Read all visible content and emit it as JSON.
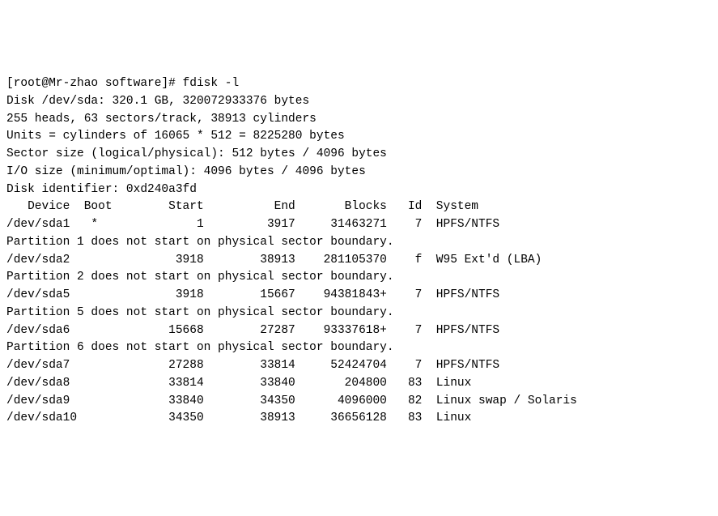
{
  "prompt": {
    "user": "root",
    "host": "Mr-zhao",
    "cwd": "software",
    "symbol": "#",
    "command": "fdisk -l"
  },
  "disk": {
    "device": "/dev/sda",
    "size": "320.1 GB",
    "bytes": "320072933376",
    "heads": "255",
    "sectors_per_track": "63",
    "cylinders": "38913",
    "units": "cylinders of 16065 * 512 = 8225280 bytes",
    "sector_size": "512 bytes / 4096 bytes",
    "io_size": "4096 bytes / 4096 bytes",
    "identifier": "0xd240a3fd"
  },
  "header": {
    "device": "Device",
    "boot": "Boot",
    "start": "Start",
    "end": "End",
    "blocks": "Blocks",
    "id": "Id",
    "system": "System"
  },
  "partitions": [
    {
      "device": "/dev/sda1",
      "boot": "*",
      "start": "1",
      "end": "3917",
      "blocks": "31463271",
      "id": "7",
      "system": "HPFS/NTFS"
    },
    {
      "device": "/dev/sda2",
      "boot": " ",
      "start": "3918",
      "end": "38913",
      "blocks": "281105370",
      "id": "f",
      "system": "W95 Ext'd (LBA)"
    },
    {
      "device": "/dev/sda5",
      "boot": " ",
      "start": "3918",
      "end": "15667",
      "blocks": "94381843+",
      "id": "7",
      "system": "HPFS/NTFS"
    },
    {
      "device": "/dev/sda6",
      "boot": " ",
      "start": "15668",
      "end": "27287",
      "blocks": "93337618+",
      "id": "7",
      "system": "HPFS/NTFS"
    },
    {
      "device": "/dev/sda7",
      "boot": " ",
      "start": "27288",
      "end": "33814",
      "blocks": "52424704",
      "id": "7",
      "system": "HPFS/NTFS"
    },
    {
      "device": "/dev/sda8",
      "boot": " ",
      "start": "33814",
      "end": "33840",
      "blocks": "204800",
      "id": "83",
      "system": "Linux"
    },
    {
      "device": "/dev/sda9",
      "boot": " ",
      "start": "33840",
      "end": "34350",
      "blocks": "4096000",
      "id": "82",
      "system": "Linux swap / Solaris"
    },
    {
      "device": "/dev/sda10",
      "boot": " ",
      "start": "34350",
      "end": "38913",
      "blocks": "36656128",
      "id": "83",
      "system": "Linux"
    }
  ],
  "warnings": [
    "Partition 1 does not start on physical sector boundary.",
    "Partition 2 does not start on physical sector boundary.",
    "Partition 5 does not start on physical sector boundary.",
    "Partition 6 does not start on physical sector boundary."
  ],
  "layout_warning_after_row": {
    "0": 0,
    "1": 1,
    "2": 2,
    "3": 3
  }
}
